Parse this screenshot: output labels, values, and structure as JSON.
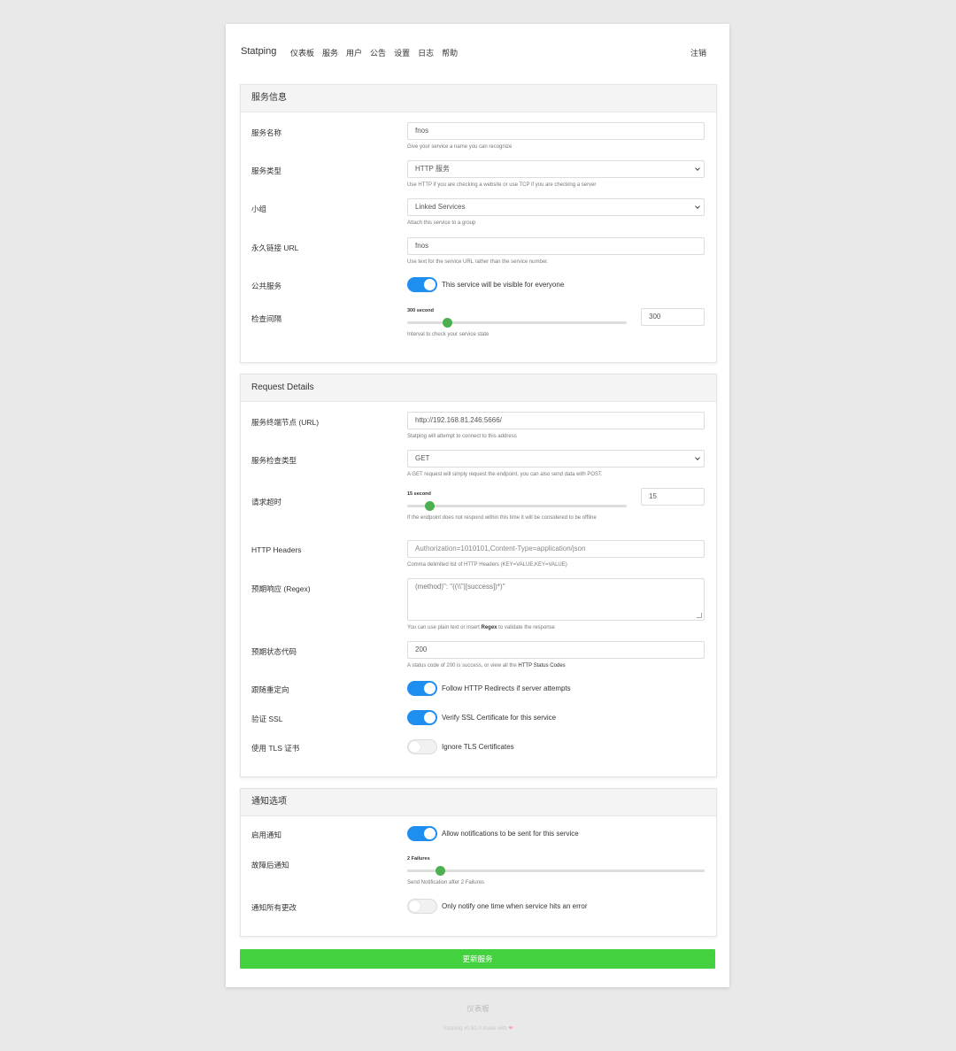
{
  "nav": {
    "brand": "Statping",
    "links": [
      "仪表板",
      "服务",
      "用户",
      "公告",
      "设置",
      "日志",
      "帮助"
    ],
    "logout": "注销"
  },
  "service_info": {
    "header": "服务信息",
    "name": {
      "label": "服务名称",
      "value": "fnos",
      "help": "Give your service a name you can recognize"
    },
    "type": {
      "label": "服务类型",
      "value": "HTTP 服务",
      "help": "Use HTTP if you are checking a website or use TCP if you are checking a server"
    },
    "group": {
      "label": "小组",
      "value": "Linked Services",
      "help": "Attach this service to a group"
    },
    "permalink": {
      "label": "永久链接 URL",
      "value": "fnos",
      "help": "Use text for the service URL rather than the service number."
    },
    "public": {
      "label": "公共服务",
      "text": "This service will be visible for everyone",
      "on": true
    },
    "interval": {
      "label": "检查间隔",
      "caption": "300 second",
      "value": "300",
      "fraction": 0.18,
      "help": "Interval to check your service state"
    }
  },
  "request": {
    "header": "Request Details",
    "endpoint": {
      "label": "服务终端节点 (URL)",
      "value": "http://192.168.81.246:5666/",
      "help": "Statping will attempt to connect to this address"
    },
    "method": {
      "label": "服务检查类型",
      "value": "GET",
      "help": "A GET request will simply request the endpoint, you can also send data with POST."
    },
    "timeout": {
      "label": "请求超时",
      "caption": "15 second",
      "value": "15",
      "fraction": 0.1,
      "help": "If the endpoint does not respond within this time it will be considered to be offline"
    },
    "headers": {
      "label": "HTTP Headers",
      "placeholder": "Authorization=1010101,Content-Type=application/json",
      "help": "Comma delimited list of HTTP Headers (KEY=VALUE,KEY=VALUE)"
    },
    "regex": {
      "label": "预期响应 (Regex)",
      "placeholder": "(method)\": \"((\\\\\"|[success])*)\"",
      "help_a": "You can use plain text or insert ",
      "help_b": "Regex",
      "help_c": " to validate the response"
    },
    "status": {
      "label": "预期状态代码",
      "value": "200",
      "help_a": "A status code of 200 is success, or view all the ",
      "help_b": "HTTP Status Codes"
    },
    "redirect": {
      "label": "跟随重定向",
      "text": "Follow HTTP Redirects if server attempts",
      "on": true
    },
    "ssl": {
      "label": "验证 SSL",
      "text": "Verify SSL Certificate for this service",
      "on": true
    },
    "tls": {
      "label": "使用 TLS 证书",
      "text": "Ignore TLS Certificates",
      "on": false
    }
  },
  "notify": {
    "header": "通知选项",
    "enable": {
      "label": "启用通知",
      "text": "Allow notifications to be sent for this service",
      "on": true
    },
    "after": {
      "label": "故障后通知",
      "caption": "2 Failures",
      "fraction": 0.11,
      "help": "Send Notification after 2 Failures"
    },
    "all": {
      "label": "通知所有更改",
      "text": "Only notify one time when service hits an error",
      "on": false
    }
  },
  "submit": "更新服务",
  "footer": {
    "link": "仪表板",
    "note": "Statping v0.91.0 made with"
  },
  "colors": {
    "toggle_on": "#1f8ef1",
    "slider": "#4caf50",
    "submit": "#43d13f"
  }
}
